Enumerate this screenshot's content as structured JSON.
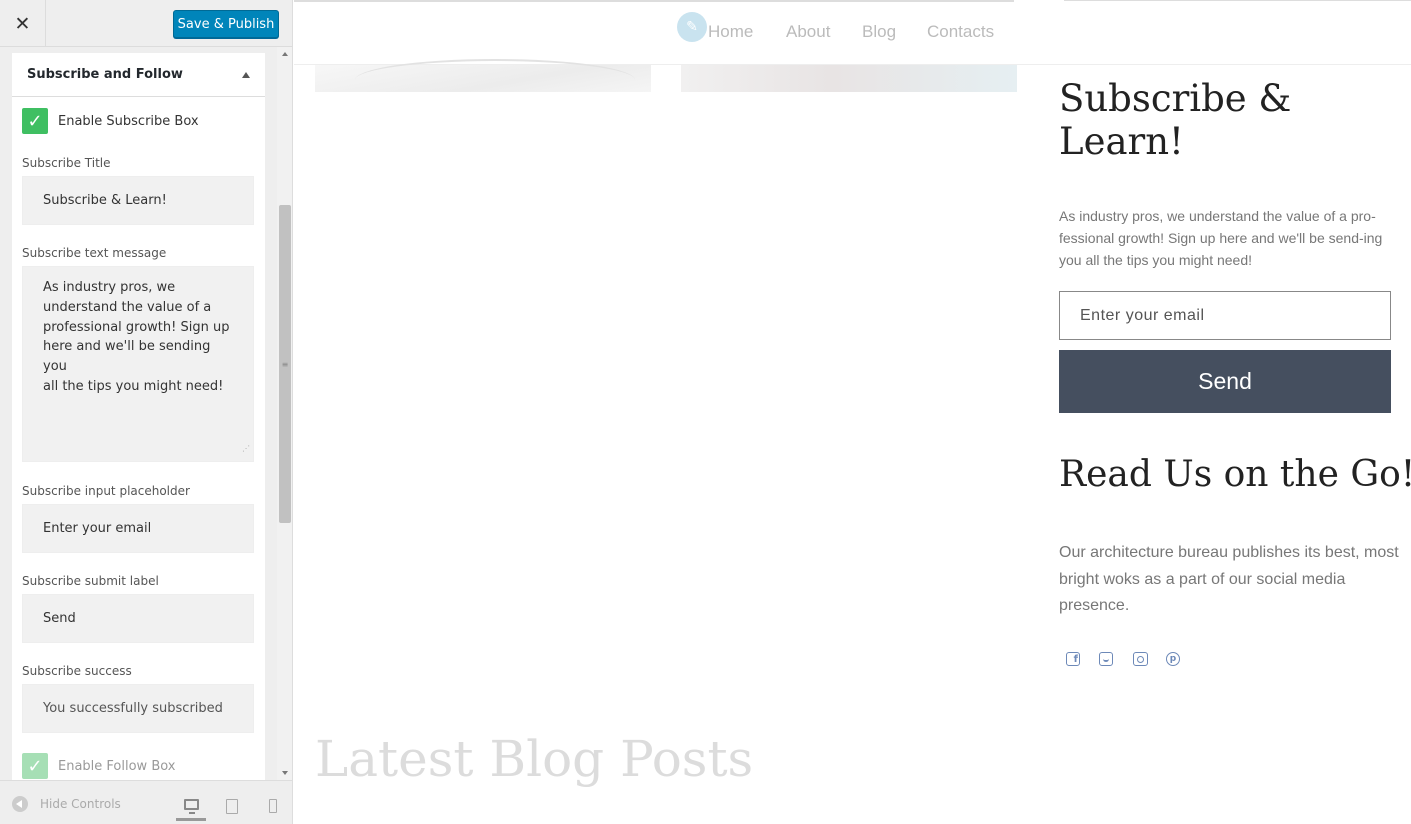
{
  "topbar": {
    "close_glyph": "✕",
    "publish_label": "Save & Publish"
  },
  "section": {
    "title": "Subscribe and Follow"
  },
  "fields": {
    "enable_subscribe_label": "Enable Subscribe Box",
    "subscribe_title_label": "Subscribe Title",
    "subscribe_title_value": "Subscribe & Learn!",
    "subscribe_text_label": "Subscribe text message",
    "subscribe_text_value": "As industry pros, we\nunderstand the value of a\nprofessional growth! Sign up\nhere and we'll be sending you\nall the tips you might need!",
    "placeholder_label": "Subscribe input placeholder",
    "placeholder_value": "Enter your email",
    "submit_label": "Subscribe submit label",
    "submit_value": "Send",
    "success_label": "Subscribe success",
    "success_value": "You successfully subscribed",
    "enable_follow_label": "Enable Follow Box",
    "checkmark_glyph": "✓"
  },
  "footer": {
    "hide_controls_label": "Hide Controls"
  },
  "preview": {
    "nav": [
      "Home",
      "About",
      "Blog",
      "Contacts"
    ],
    "edit_glyph": "✎",
    "subscribe_heading": "Subscribe & Learn!",
    "subscribe_text": "As industry pros, we understand the value of a pro-fessional growth! Sign up here and we'll be send-ing you all the tips you might need!",
    "email_placeholder": "Enter your email",
    "send_label": "Send",
    "follow_heading": "Read Us on the Go!",
    "follow_text": "Our architecture bureau publishes its best, most bright woks as a part of our social media presence.",
    "blog_heading": "Latest Blog Posts",
    "social_icons": [
      "facebook-icon",
      "twitter-icon",
      "instagram-icon",
      "pinterest-icon"
    ],
    "facebook_glyph": "f",
    "pinterest_glyph": "p"
  },
  "colors": {
    "publish_button": "#0085ba",
    "checkbox_green": "#3fbf62",
    "send_button": "#454f5f",
    "social_icon": "#6d89b8"
  }
}
